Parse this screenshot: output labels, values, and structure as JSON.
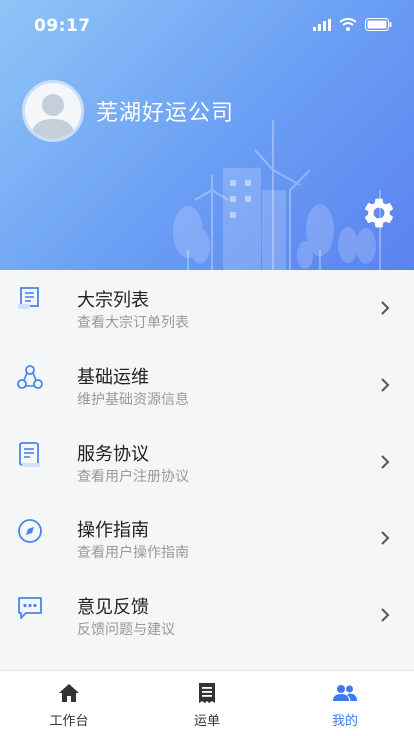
{
  "status_bar": {
    "time": "09:17"
  },
  "profile": {
    "company_name": "芜湖好运公司"
  },
  "menu": [
    {
      "title": "大宗列表",
      "subtitle": "查看大宗订单列表",
      "icon": "bulk-list-icon"
    },
    {
      "title": "基础运维",
      "subtitle": "维护基础资源信息",
      "icon": "network-nodes-icon"
    },
    {
      "title": "服务协议",
      "subtitle": "查看用户注册协议",
      "icon": "document-icon"
    },
    {
      "title": "操作指南",
      "subtitle": "查看用户操作指南",
      "icon": "compass-icon"
    },
    {
      "title": "意见反馈",
      "subtitle": "反馈问题与建议",
      "icon": "chat-bubble-icon"
    }
  ],
  "tabs": [
    {
      "label": "工作台",
      "icon": "home-icon",
      "active": false
    },
    {
      "label": "运单",
      "icon": "receipt-icon",
      "active": false
    },
    {
      "label": "我的",
      "icon": "people-icon",
      "active": true
    }
  ],
  "colors": {
    "accent": "#3a7bf0",
    "header_start": "#8ec5f7",
    "header_end": "#5b82f0",
    "icon": "#4a86e8"
  }
}
